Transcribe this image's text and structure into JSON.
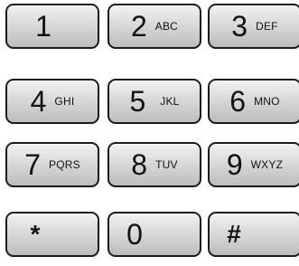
{
  "keypad": {
    "keys": [
      {
        "digit": "1",
        "letters": ""
      },
      {
        "digit": "2",
        "letters": "ABC"
      },
      {
        "digit": "3",
        "letters": "DEF"
      },
      {
        "digit": "4",
        "letters": "GHI"
      },
      {
        "digit": "5",
        "letters": "JKL"
      },
      {
        "digit": "6",
        "letters": "MNO"
      },
      {
        "digit": "7",
        "letters": "PQRS"
      },
      {
        "digit": "8",
        "letters": "TUV"
      },
      {
        "digit": "9",
        "letters": "WXYZ"
      },
      {
        "digit": "*",
        "letters": ""
      },
      {
        "digit": "0",
        "letters": ""
      },
      {
        "digit": "#",
        "letters": ""
      }
    ]
  },
  "colors": {
    "key_border": "#1a1a1a",
    "key_gradient_top": "#f2f2f2",
    "key_gradient_bottom": "#bdbdbd",
    "text": "#111111"
  }
}
